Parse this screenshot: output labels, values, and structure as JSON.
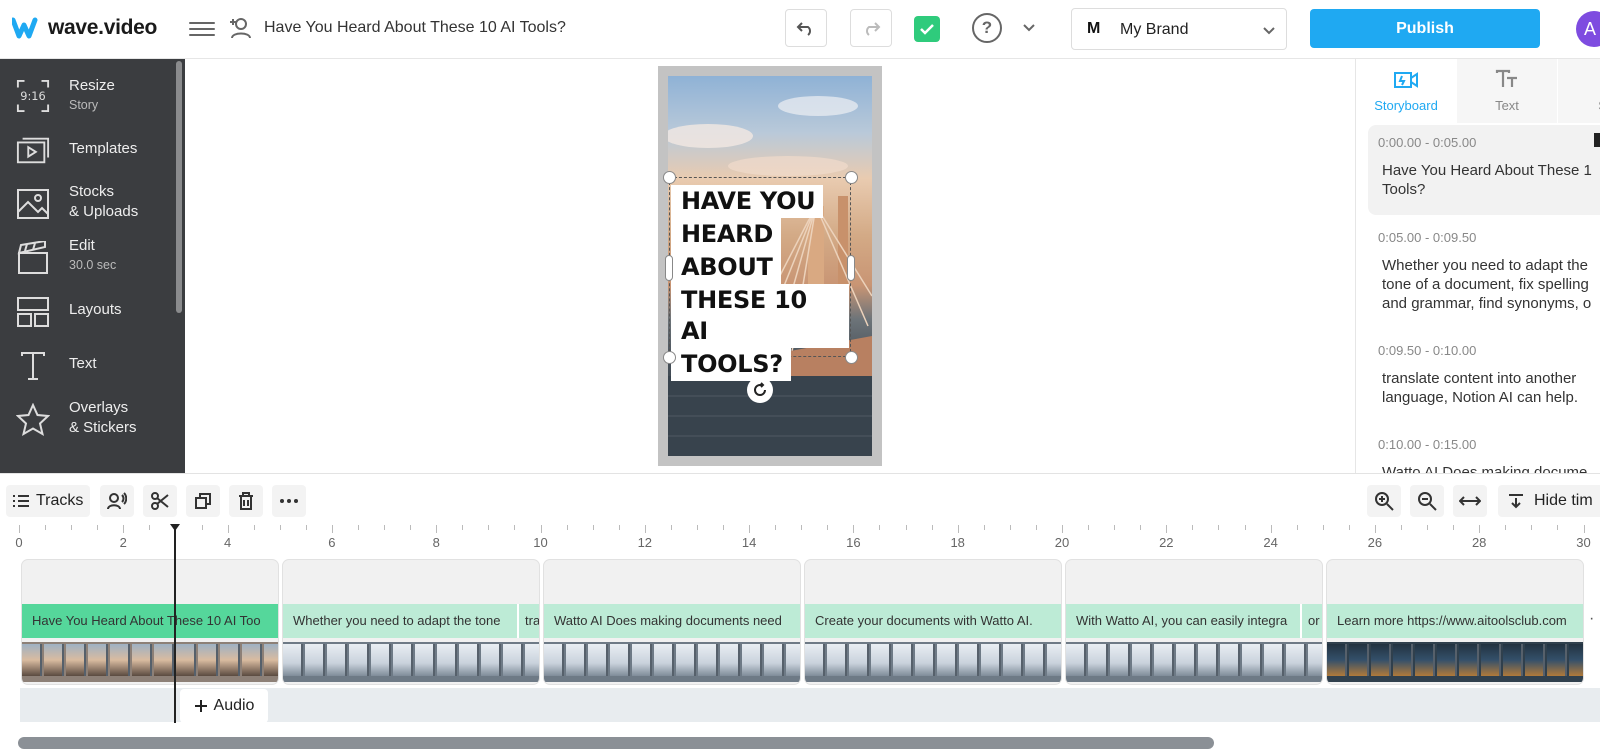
{
  "app": {
    "logo_text": "wave.video",
    "project_title": "Have You Heard About These 10 AI Tools?"
  },
  "brand": {
    "initial": "M",
    "name": "My Brand"
  },
  "actions": {
    "publish_label": "Publish",
    "avatar_initial": "A"
  },
  "colors": {
    "accent": "#1fa9f2",
    "sidebar_bg": "#3b3d40",
    "caption_active": "#55d79b",
    "caption": "#bdebd6",
    "success": "#2fcb7c",
    "avatar": "#7e4ce0"
  },
  "sidebar": {
    "items": [
      {
        "icon": "aspect-ratio-icon",
        "label": "Resize",
        "sub": "Story",
        "icon_text": "9:16"
      },
      {
        "icon": "templates-icon",
        "label": "Templates",
        "sub": ""
      },
      {
        "icon": "image-icon",
        "label": "Stocks",
        "label2": "& Uploads",
        "sub": ""
      },
      {
        "icon": "clapperboard-icon",
        "label": "Edit",
        "sub": "30.0 sec"
      },
      {
        "icon": "layouts-icon",
        "label": "Layouts",
        "sub": ""
      },
      {
        "icon": "text-icon",
        "label": "Text",
        "sub": ""
      },
      {
        "icon": "star-icon",
        "label": "Overlays",
        "label2": "& Stickers",
        "sub": ""
      }
    ]
  },
  "canvas": {
    "headline_lines": [
      "HAVE YOU",
      "HEARD",
      "ABOUT",
      "THESE 10 AI",
      "TOOLS?"
    ]
  },
  "right_panel": {
    "tabs": [
      {
        "icon": "storyboard-icon",
        "label": "Storyboard",
        "active": true
      },
      {
        "icon": "text-style-icon",
        "label": "Text",
        "active": false
      },
      {
        "icon": "settings-icon",
        "label": "Set",
        "active": false
      }
    ],
    "scenes": [
      {
        "time": "0:00.00 - 0:05.00",
        "text": "Have You Heard About These 1\nTools?"
      },
      {
        "time": "0:05.00 - 0:09.50",
        "text": "Whether you need to adapt the\ntone of a document, fix spelling\nand grammar, find synonyms, o"
      },
      {
        "time": "0:09.50 - 0:10.00",
        "text": "translate content into another\nlanguage, Notion AI can help."
      },
      {
        "time": "0:10.00 - 0:15.00",
        "text": "Watto AI Does making docume"
      }
    ]
  },
  "timeline": {
    "tracks_label": "Tracks",
    "hide_label": "Hide tim",
    "ruler_labels": [
      "0",
      "2",
      "4",
      "6",
      "8",
      "10",
      "12",
      "14",
      "16",
      "18",
      "20",
      "22",
      "24",
      "26",
      "28",
      "30"
    ],
    "audio_label": "Audio",
    "playhead_seconds": 3.0,
    "clips": [
      {
        "caption": "Have You Heard About These 10 AI Too",
        "sub": "",
        "active": true
      },
      {
        "caption": "Whether you need to adapt the tone",
        "sub": "tra"
      },
      {
        "caption": "Watto AI Does making documents need",
        "sub": ""
      },
      {
        "caption": "Create your documents with Watto AI.",
        "sub": ""
      },
      {
        "caption": "With Watto AI, you can easily integra",
        "sub": "or"
      },
      {
        "caption": "Learn more https://www.aitoolsclub.com",
        "sub": ""
      }
    ]
  }
}
